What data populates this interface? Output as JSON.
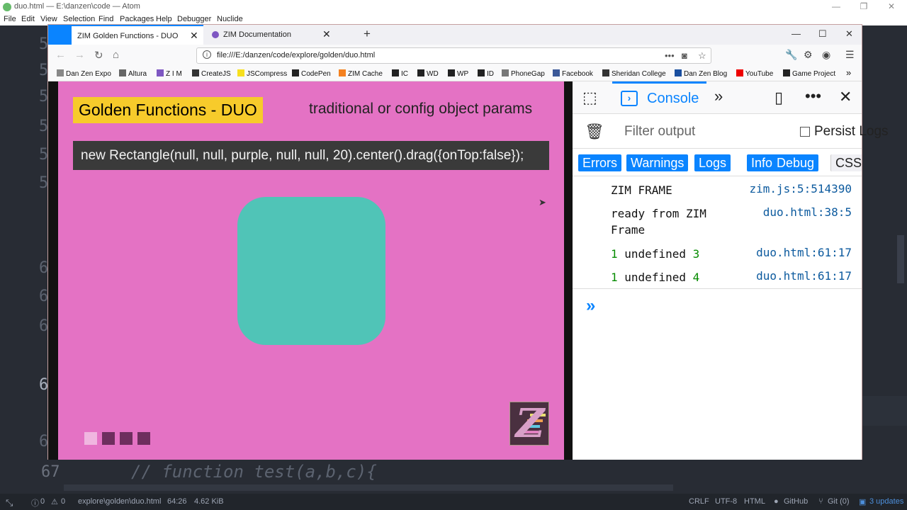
{
  "atom": {
    "title": "duo.html — E:\\danzen\\code — Atom",
    "menu": [
      "File",
      "Edit",
      "View",
      "Selection",
      "Find",
      "Packages",
      "Help",
      "Debugger",
      "Nuclide"
    ],
    "code_line": "// function test(a,b,c){",
    "line_number": "67",
    "gutter": [
      "5",
      "5",
      "5",
      "5",
      "5",
      "5",
      "6",
      "6",
      "6",
      "6",
      "6"
    ],
    "status": {
      "errors": "0",
      "warnings": "0",
      "file_path": "explore\\golden\\duo.html",
      "cursor": "64:26",
      "size": "4.62 KiB",
      "line_ending": "CRLF",
      "encoding": "UTF-8",
      "grammar": "HTML",
      "github": "GitHub",
      "git": "Git (0)",
      "updates": "3 updates"
    }
  },
  "firefox": {
    "tabs": [
      {
        "label": "ZIM Golden Functions - DUO",
        "close": "✕"
      },
      {
        "label": "ZIM Documentation",
        "close": "✕"
      }
    ],
    "new_tab": "+",
    "url": "file:///E:/danzen/code/explore/golden/duo.html",
    "bookmarks": [
      "Dan Zen Expo",
      "Altura",
      "Z I M",
      "CreateJS",
      "JSCompress",
      "CodePen",
      "ZIM Cache",
      "IC",
      "WD",
      "WP",
      "ID",
      "PhoneGap",
      "Facebook",
      "Sheridan College",
      "Dan Zen Blog",
      "YouTube",
      "Game Project"
    ]
  },
  "page": {
    "title": "Golden Functions - DUO",
    "subtitle": "traditional or config object params",
    "code": "new Rectangle(null, null, purple, null, null, 20).center().drag({onTop:false});",
    "logo": "Z"
  },
  "devtools": {
    "console_label": "Console",
    "filter_placeholder": "Filter output",
    "persist_label": "Persist Logs",
    "levels": [
      "Errors",
      "Warnings",
      "Logs",
      "Info",
      "Debug"
    ],
    "css_label": "CSS",
    "messages": [
      {
        "text": "ZIM FRAME",
        "source": "zim.js:5:514390"
      },
      {
        "text_line1": "ready from ZIM",
        "text_line2": "Frame",
        "source": "duo.html:38:5"
      },
      {
        "a": "1",
        "mid": "undefined",
        "b": "3",
        "source": "duo.html:61:17"
      },
      {
        "a": "1",
        "mid": "undefined",
        "b": "4",
        "source": "duo.html:61:17"
      }
    ],
    "prompt": "»"
  },
  "colors": {
    "page_bg": "#e472c4",
    "title_bg": "#f7cb2b",
    "rect": "#50c4b7",
    "accent": "#0a84ff"
  }
}
